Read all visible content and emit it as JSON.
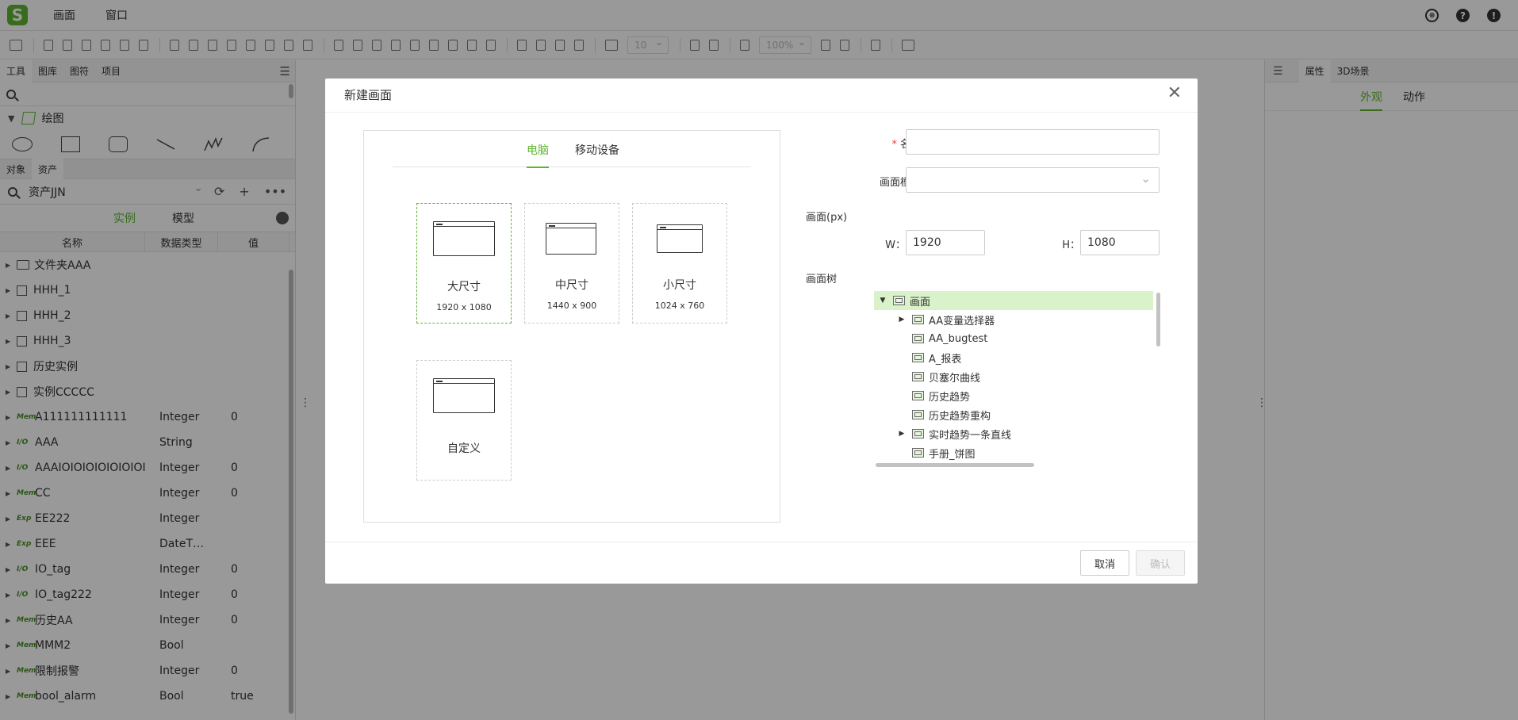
{
  "app": {
    "menu": [
      "画面",
      "窗口"
    ],
    "logo_glyph": "S",
    "help_glyph": "?",
    "info_glyph": "!"
  },
  "toolbar": {
    "grid_value": "10",
    "zoom_value": "100%"
  },
  "left_panel": {
    "top_tabs": [
      "工具",
      "图库",
      "图符",
      "项目"
    ],
    "draw_section": "绘图",
    "lower_tabs": [
      "对象",
      "资产"
    ],
    "asset_select": "资产JJN",
    "modes": [
      "实例",
      "模型"
    ],
    "columns": [
      "名称",
      "数据类型",
      "值"
    ],
    "rows": [
      {
        "icon": "folder",
        "name": "文件夹AAA",
        "type": "",
        "value": ""
      },
      {
        "icon": "box",
        "name": "HHH_1",
        "type": "",
        "value": ""
      },
      {
        "icon": "box",
        "name": "HHH_2",
        "type": "",
        "value": ""
      },
      {
        "icon": "box",
        "name": "HHH_3",
        "type": "",
        "value": ""
      },
      {
        "icon": "box",
        "name": "历史实例",
        "type": "",
        "value": ""
      },
      {
        "icon": "box",
        "name": "实例CCCCC",
        "type": "",
        "value": ""
      },
      {
        "icon": "Mem",
        "name": "A111111111111",
        "type": "Integer",
        "value": "0"
      },
      {
        "icon": "I/O",
        "name": "AAA",
        "type": "String",
        "value": ""
      },
      {
        "icon": "I/O",
        "name": "AAAIOIOIOIOIOIOIOIC",
        "type": "Integer",
        "value": "0"
      },
      {
        "icon": "Mem",
        "name": "CC",
        "type": "Integer",
        "value": "0"
      },
      {
        "icon": "Exp",
        "name": "EE222",
        "type": "Integer",
        "value": ""
      },
      {
        "icon": "Exp",
        "name": "EEE",
        "type": "DateT…",
        "value": ""
      },
      {
        "icon": "I/O",
        "name": "IO_tag",
        "type": "Integer",
        "value": "0"
      },
      {
        "icon": "I/O",
        "name": "IO_tag222",
        "type": "Integer",
        "value": "0"
      },
      {
        "icon": "Mem",
        "name": "历史AA",
        "type": "Integer",
        "value": "0"
      },
      {
        "icon": "Mem",
        "name": "MMM2",
        "type": "Bool",
        "value": ""
      },
      {
        "icon": "Mem",
        "name": "限制报警",
        "type": "Integer",
        "value": "0"
      },
      {
        "icon": "Mem",
        "name": "bool_alarm",
        "type": "Bool",
        "value": "true"
      }
    ]
  },
  "right_panel": {
    "tabs": [
      "属性",
      "3D场景"
    ],
    "sub_tabs": [
      "外观",
      "动作"
    ]
  },
  "dialog": {
    "title": "新建画面",
    "device_tabs": [
      "电脑",
      "移动设备"
    ],
    "sizes": [
      {
        "label": "大尺寸",
        "dims": "1920 x 1080"
      },
      {
        "label": "中尺寸",
        "dims": "1440 x 900"
      },
      {
        "label": "小尺寸",
        "dims": "1024 x 760"
      },
      {
        "label": "自定义",
        "dims": ""
      }
    ],
    "name_label": "名称：",
    "required_mark": "*",
    "name_value": "",
    "template_label": "画面模板：",
    "template_value": "",
    "canvas_label": "画面(px)",
    "w_label": "W：",
    "w_value": "1920",
    "h_label": "H：",
    "h_value": "1080",
    "tree_label": "画面树",
    "tree": [
      {
        "label": "画面",
        "expand": "down",
        "level": 0
      },
      {
        "label": "AA变量选择器",
        "expand": "right",
        "level": 1
      },
      {
        "label": "AA_bugtest",
        "expand": "",
        "level": 1
      },
      {
        "label": "A_报表",
        "expand": "",
        "level": 1
      },
      {
        "label": "贝塞尔曲线",
        "expand": "",
        "level": 1
      },
      {
        "label": "历史趋势",
        "expand": "",
        "level": 1
      },
      {
        "label": "历史趋势重构",
        "expand": "",
        "level": 1
      },
      {
        "label": "实时趋势一条直线",
        "expand": "right",
        "level": 1
      },
      {
        "label": "手册_饼图",
        "expand": "",
        "level": 1
      }
    ],
    "cancel": "取消",
    "confirm": "确认"
  },
  "colors": {
    "accent": "#5cb531",
    "tree_selected_bg": "#d9f2c9"
  }
}
